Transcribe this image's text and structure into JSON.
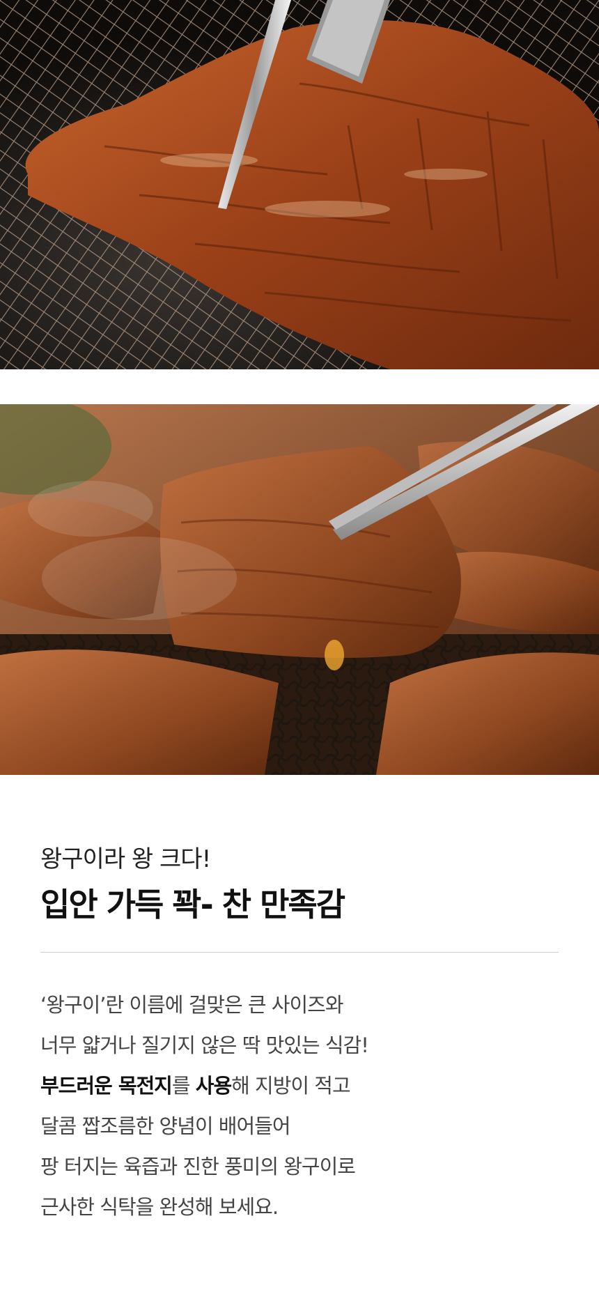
{
  "images": {
    "top": {
      "alt": "grilled-marinated-pork-on-mesh-grill-with-tongs-icon"
    },
    "bottom": {
      "alt": "grilled-pork-pieces-with-chopsticks-icon"
    }
  },
  "headline": {
    "subtitle": "왕구이라 왕 크다!",
    "title": "입안 가득 꽉- 찬 만족감"
  },
  "description": {
    "line1": "‘왕구이’란 이름에 걸맞은 큰 사이즈와",
    "line2": "너무 얇거나 질기지 않은 딱 맛있는 식감!",
    "line3_bold_a": "부드러운 목전지",
    "line3_text_a": "를 ",
    "line3_bold_b": "사용",
    "line3_text_b": "해 지방이 적고",
    "line4": "달콤 짭조름한 양념이 배어들어",
    "line5": "팡 터지는 육즙과 진한 풍미의 왕구이로",
    "line6": "근사한 식탁을 완성해 보세요."
  },
  "colors": {
    "meat": "#8a3a18",
    "meat_light": "#b8592a",
    "grill": "#1a1410",
    "text": "#222222",
    "divider": "#cfcfcf"
  }
}
